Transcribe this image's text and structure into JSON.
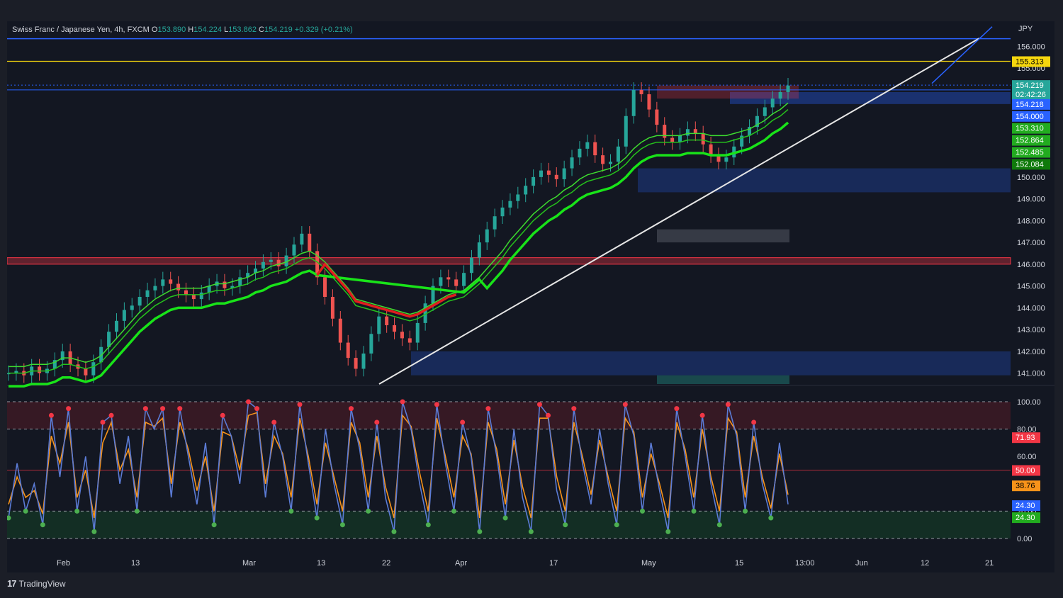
{
  "header": {
    "symbol": "Swiss Franc / Japanese Yen, 4h, FXCM",
    "o_label": "O",
    "o": "153.890",
    "h_label": "H",
    "h": "154.224",
    "l_label": "L",
    "l": "153.862",
    "c_label": "C",
    "c": "154.219",
    "change": "+0.329 (+0.21%)",
    "currency": "JPY"
  },
  "footer": {
    "brand": "TradingView"
  },
  "chart_data": [
    {
      "type": "line",
      "name": "price",
      "ylim": [
        140.5,
        156.5
      ],
      "y_ticks": [
        "156.000",
        "155.000",
        "154.000",
        "150.000",
        "149.000",
        "148.000",
        "147.000",
        "146.000",
        "145.000",
        "144.000",
        "143.000",
        "142.000",
        "141.000"
      ],
      "x_ticks": [
        "Feb",
        "13",
        "Mar",
        "13",
        "22",
        "Apr",
        "17",
        "May",
        "15",
        "13:00",
        "Jun",
        "12",
        "21"
      ],
      "price_labels": [
        {
          "text": "155.313",
          "value": 155.313,
          "bg": "#f5d60e",
          "fg": "#000000"
        },
        {
          "text": "154.219",
          "value": 154.219,
          "bg": "#26a69a",
          "fg": "#ffffff"
        },
        {
          "text": "02:42:26",
          "value": 153.8,
          "bg": "#26a69a",
          "fg": "#ffffff"
        },
        {
          "text": "154.218",
          "value": 153.35,
          "bg": "#2962ff",
          "fg": "#ffffff"
        },
        {
          "text": "154.000",
          "value": 152.8,
          "bg": "#2962ff",
          "fg": "#ffffff"
        },
        {
          "text": "153.310",
          "value": 152.25,
          "bg": "#22ab1f",
          "fg": "#ffffff"
        },
        {
          "text": "152.864",
          "value": 151.7,
          "bg": "#22ab1f",
          "fg": "#ffffff"
        },
        {
          "text": "152.485",
          "value": 151.15,
          "bg": "#22ab1f",
          "fg": "#ffffff"
        },
        {
          "text": "152.084",
          "value": 150.6,
          "bg": "#0f7a0b",
          "fg": "#ffffff"
        }
      ],
      "candles_close": [
        141.0,
        141.1,
        140.9,
        141.3,
        141.0,
        141.2,
        141.6,
        142.0,
        141.4,
        141.2,
        140.9,
        141.5,
        142.2,
        142.9,
        143.4,
        143.9,
        144.1,
        144.5,
        144.8,
        145.0,
        145.3,
        145.1,
        144.8,
        144.6,
        144.4,
        144.7,
        145.0,
        145.2,
        144.9,
        145.0,
        145.4,
        145.6,
        145.8,
        146.1,
        146.2,
        145.9,
        146.4,
        146.9,
        147.4,
        146.6,
        145.4,
        144.5,
        143.5,
        142.4,
        141.7,
        141.2,
        141.9,
        142.8,
        143.6,
        143.2,
        142.9,
        142.6,
        142.4,
        143.3,
        144.2,
        145.0,
        145.4,
        145.3,
        145.0,
        145.6,
        146.3,
        147.0,
        147.6,
        148.2,
        148.6,
        148.9,
        149.2,
        149.6,
        150.0,
        150.3,
        150.1,
        149.9,
        150.4,
        150.9,
        151.3,
        151.6,
        151.0,
        150.6,
        150.7,
        151.4,
        152.8,
        154.0,
        153.8,
        153.1,
        152.4,
        151.8,
        151.6,
        151.9,
        152.2,
        152.0,
        151.5,
        151.0,
        150.7,
        150.9,
        151.4,
        151.9,
        152.3,
        152.8,
        153.2,
        153.6,
        153.9,
        154.2
      ],
      "ema_fast": [
        141.0,
        141.0,
        141.0,
        141.1,
        141.1,
        141.1,
        141.2,
        141.4,
        141.4,
        141.3,
        141.2,
        141.3,
        141.5,
        141.9,
        142.3,
        142.7,
        143.1,
        143.5,
        143.8,
        144.1,
        144.3,
        144.5,
        144.6,
        144.6,
        144.6,
        144.6,
        144.7,
        144.8,
        144.8,
        144.9,
        145.0,
        145.1,
        145.3,
        145.4,
        145.6,
        145.7,
        145.8,
        146.0,
        146.2,
        146.3,
        146.1,
        145.8,
        145.4,
        145.0,
        144.6,
        144.1,
        144.0,
        143.9,
        143.8,
        143.7,
        143.6,
        143.5,
        143.4,
        143.5,
        143.7,
        143.9,
        144.1,
        144.3,
        144.4,
        144.5,
        144.8,
        145.1,
        145.5,
        145.9,
        146.3,
        146.8,
        147.2,
        147.6,
        148.0,
        148.3,
        148.6,
        148.8,
        149.1,
        149.3,
        149.6,
        149.8,
        149.9,
        150.0,
        150.1,
        150.3,
        150.6,
        151.0,
        151.3,
        151.5,
        151.6,
        151.6,
        151.6,
        151.6,
        151.7,
        151.7,
        151.7,
        151.6,
        151.6,
        151.6,
        151.7,
        151.8,
        151.9,
        152.1,
        152.3,
        152.6,
        152.8,
        153.1
      ]
    },
    {
      "type": "line",
      "name": "oscillator",
      "ylim": [
        0,
        100
      ],
      "y_ticks": [
        "100.00",
        "80.00",
        "60.00",
        "40.00",
        "20.00",
        "0.00"
      ],
      "y_tick_values": [
        100,
        80,
        60,
        40,
        20,
        0
      ],
      "levels": [
        {
          "text": "71.93",
          "value": 74,
          "bg": "#f23645",
          "fg": "#ffffff"
        },
        {
          "text": "50.00",
          "value": 50,
          "bg": "#f23645",
          "fg": "#ffffff"
        },
        {
          "text": "38.76",
          "value": 38.76,
          "bg": "#f7931a",
          "fg": "#000000"
        },
        {
          "text": "24.30",
          "value": 24.3,
          "bg": "#2962ff",
          "fg": "#ffffff"
        },
        {
          "text": "24.30",
          "value": 15.5,
          "bg": "#22ab1f",
          "fg": "#ffffff"
        }
      ],
      "k_values": [
        15,
        55,
        20,
        40,
        10,
        90,
        45,
        95,
        20,
        60,
        5,
        85,
        90,
        40,
        75,
        20,
        95,
        80,
        95,
        30,
        95,
        60,
        25,
        70,
        10,
        90,
        75,
        40,
        100,
        95,
        30,
        85,
        60,
        20,
        98,
        55,
        15,
        80,
        40,
        10,
        95,
        65,
        20,
        85,
        30,
        5,
        100,
        80,
        40,
        10,
        98,
        55,
        20,
        85,
        60,
        5,
        95,
        60,
        15,
        80,
        30,
        5,
        98,
        90,
        35,
        10,
        95,
        55,
        25,
        80,
        40,
        10,
        98,
        75,
        20,
        70,
        35,
        5,
        95,
        60,
        20,
        90,
        40,
        10,
        98,
        75,
        20,
        85,
        40,
        15,
        70,
        25
      ],
      "d_values": [
        25,
        45,
        30,
        35,
        18,
        75,
        55,
        85,
        30,
        50,
        15,
        70,
        85,
        50,
        65,
        30,
        85,
        82,
        88,
        40,
        85,
        65,
        35,
        60,
        20,
        78,
        75,
        50,
        90,
        92,
        40,
        75,
        62,
        30,
        88,
        60,
        25,
        70,
        45,
        20,
        85,
        70,
        30,
        75,
        38,
        15,
        90,
        82,
        48,
        20,
        88,
        60,
        30,
        75,
        62,
        15,
        85,
        65,
        25,
        72,
        38,
        15,
        88,
        88,
        45,
        20,
        85,
        60,
        32,
        72,
        45,
        20,
        88,
        78,
        30,
        62,
        40,
        15,
        85,
        65,
        30,
        80,
        45,
        20,
        88,
        78,
        30,
        75,
        45,
        22,
        62,
        32
      ]
    }
  ]
}
